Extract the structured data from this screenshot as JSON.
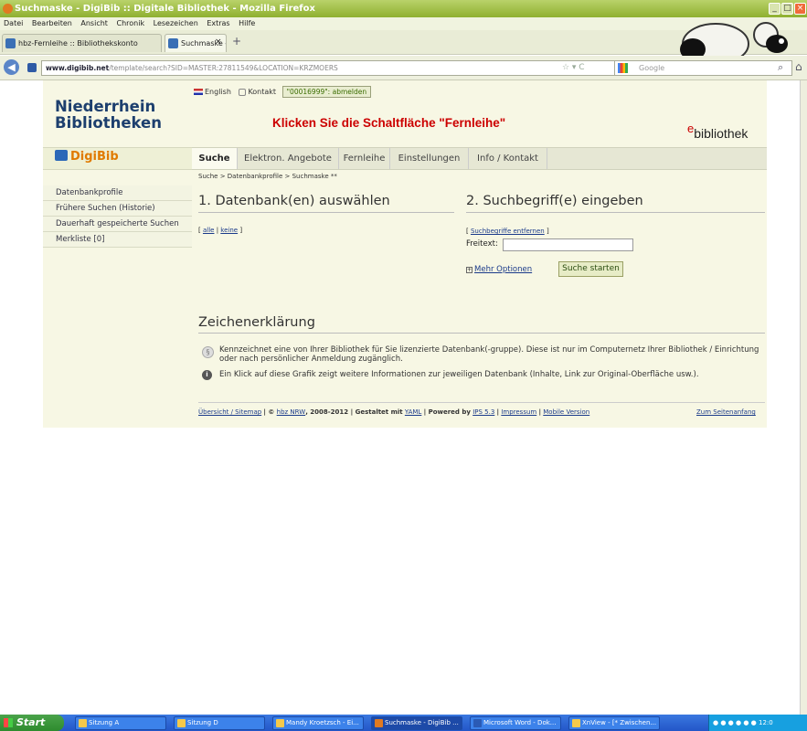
{
  "window": {
    "title": "Suchmaske - DigiBib :: Digitale Bibliothek - Mozilla Firefox",
    "controls": [
      "_",
      "□",
      "×"
    ]
  },
  "menubar": [
    "Datei",
    "Bearbeiten",
    "Ansicht",
    "Chronik",
    "Lesezeichen",
    "Extras",
    "Hilfe"
  ],
  "tabs": [
    {
      "label": "hbz-Fernleihe :: Bibliothekskonto"
    },
    {
      "label": "Suchmaske - DigiBib :: Digitale Bibliothek"
    }
  ],
  "tab_close": "×",
  "new_tab": "+",
  "navbar": {
    "url_domain": "www.digibib.net",
    "url_rest": "/template/search?SID=MASTER:27811549&LOCATION=KRZMOERS",
    "url_icons": "☆ ▾ C",
    "search_placeholder": "Google"
  },
  "page": {
    "english_link": "English",
    "contact_link": "Kontakt",
    "logout_button": "\"00016999\": abmelden",
    "logo_line1": "Niederrhein",
    "logo_line2": "Bibliotheken",
    "headline": "Klicken Sie die Schaltfläche \"Fernleihe\"",
    "ebib_e": "e",
    "ebib_rest": "bibliothek",
    "brand": "DigiBib",
    "nav_tabs": [
      "Suche",
      "Elektron. Angebote",
      "Fernleihe",
      "Einstellungen",
      "Info / Kontakt"
    ],
    "breadcrumb": "Suche > Datenbankprofile > Suchmaske **",
    "sidebar": [
      "Datenbankprofile",
      "Frühere Suchen (Historie)",
      "Dauerhaft gespeicherte Suchen",
      "Merkliste [0]"
    ],
    "section1_title": "1. Datenbank(en) auswählen",
    "section2_title": "2. Suchbegriff(e) eingeben",
    "link_all_open": "[",
    "link_all": "alle",
    "link_sep": "|",
    "link_none": "keine",
    "link_all_close": "]",
    "clear_link": "Suchbegriffe entfernen",
    "freitext_label": "Freitext:",
    "freitext_value": "",
    "more_options": "Mehr Optionen",
    "search_button": "Suche starten",
    "legend_title": "Zeichenerklärung",
    "legend1": "Kennzeichnet eine von Ihrer Bibliothek für Sie lizenzierte Datenbank(-gruppe). Diese ist nur im Computernetz Ihrer Bibliothek / Einrichtung oder nach persönlicher Anmeldung zugänglich.",
    "legend2": "Ein Klick auf diese Grafik zeigt weitere Informationen zur jeweiligen Datenbank (Inhalte, Link zur Original-Oberfläche usw.).",
    "footer": {
      "sitemap": "Übersicht / Sitemap",
      "copy_prefix": "| ©",
      "hbz": "hbz NRW",
      "years": ", 2008-2012 | Gestaltet mit",
      "yaml": "YAML",
      "powered": "| Powered by",
      "ips": "IPS 5.3",
      "sep1": "|",
      "impressum": "Impressum",
      "sep2": "|",
      "mobile": "Mobile Version",
      "top": "Zum Seitenanfang"
    }
  },
  "taskbar": {
    "start": "Start",
    "tasks": [
      "Sitzung A",
      "Sitzung D",
      "Mandy Kroetzsch - Ei...",
      "Suchmaske - DigiBib ...",
      "Microsoft Word - Dok...",
      "XnView - [* Zwischen..."
    ],
    "clock": "12:0"
  }
}
